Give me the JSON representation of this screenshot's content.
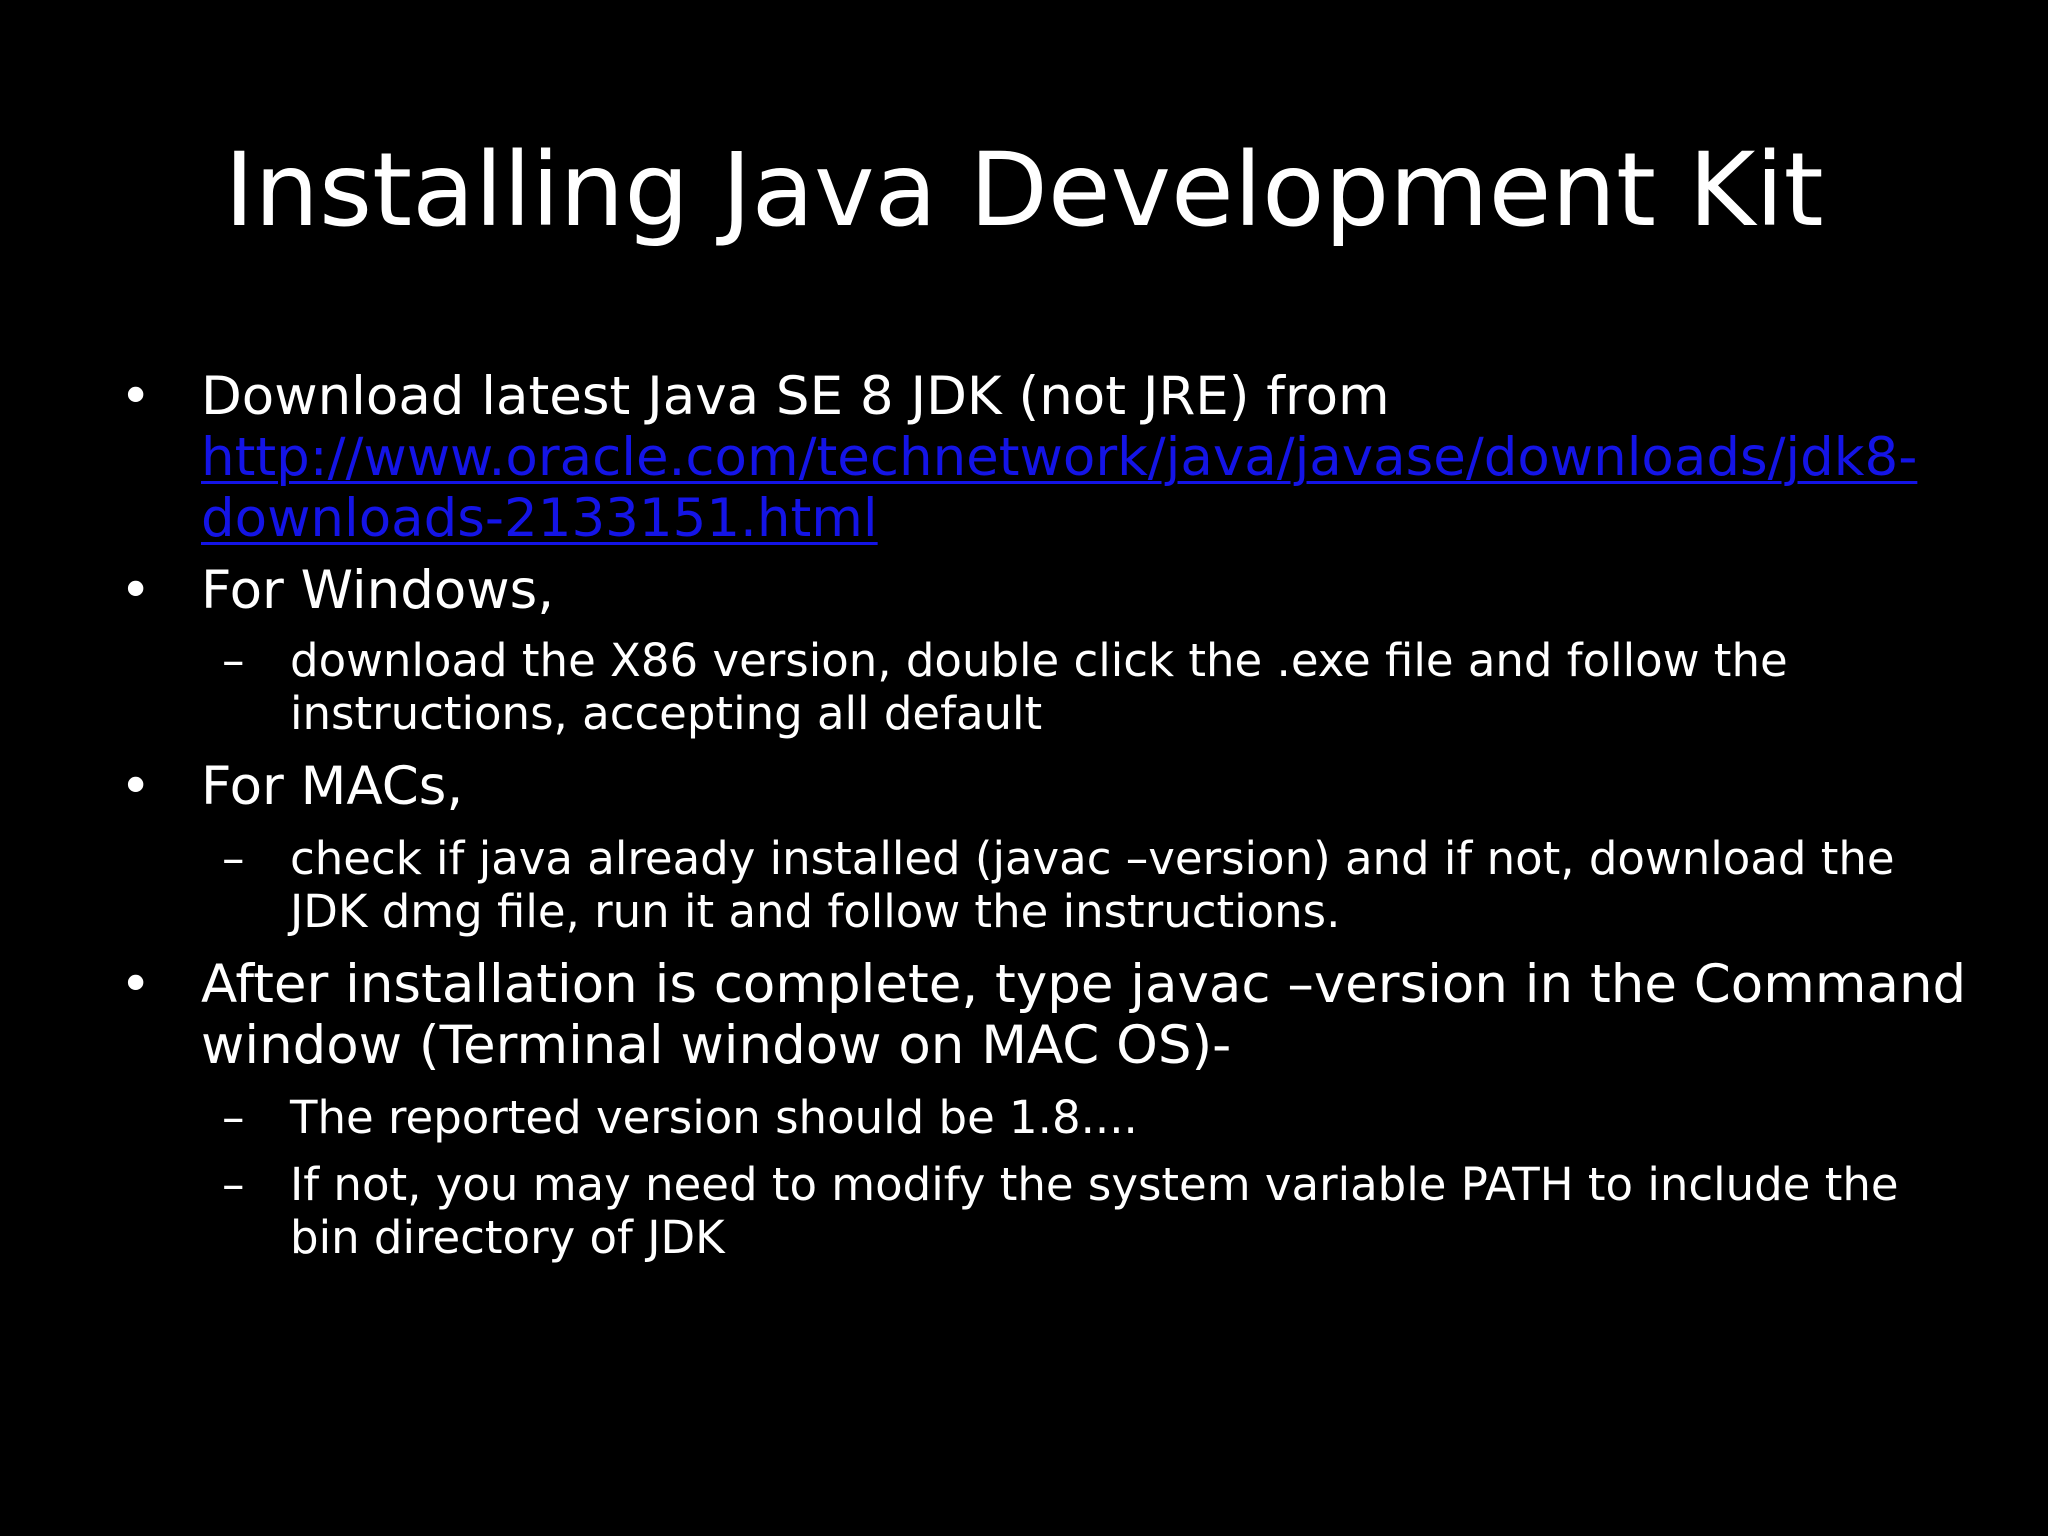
{
  "slide": {
    "title": "Installing Java Development  Kit",
    "bullet_symbol": "•",
    "sub_symbol": "–",
    "bullet1": {
      "line1": "Download latest Java SE 8 JDK (not JRE) from",
      "link_line1": "http://www.oracle.com/technetwork/java/javase/downloads/jdk8-",
      "link_line2": "downloads-2133151.html"
    },
    "bullet2": {
      "line1": "For Windows,",
      "sub1": {
        "line1": "download the X86 version, double click the .exe file and follow the",
        "line2": "instructions, accepting all default"
      }
    },
    "bullet3": {
      "line1": "For MACs,",
      "sub1": {
        "line1": "check if java already installed (javac –version) and if not, download the",
        "line2": "JDK dmg file, run it and follow the instructions."
      }
    },
    "bullet4": {
      "line1": "After installation is complete, type javac –version in the Command",
      "line2": "window (Terminal window on MAC OS)-",
      "sub1": {
        "line1": "The reported version should be 1.8...."
      },
      "sub2": {
        "line1": "If not, you may need to modify the system variable PATH to include the",
        "line2": "bin directory of JDK"
      }
    },
    "colors": {
      "background": "#000000",
      "text": "#ffffff",
      "link": "#1414e6"
    }
  }
}
